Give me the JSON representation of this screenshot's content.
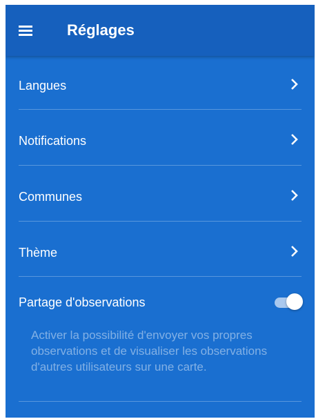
{
  "app_bar": {
    "title": "Réglages",
    "menu_icon": "menu-icon"
  },
  "settings": {
    "items": [
      {
        "label": "Langues",
        "icon": "chevron-right-icon"
      },
      {
        "label": "Notifications",
        "icon": "chevron-right-icon"
      },
      {
        "label": "Communes",
        "icon": "chevron-right-icon"
      },
      {
        "label": "Thème",
        "icon": "chevron-right-icon"
      }
    ],
    "share": {
      "label": "Partage d'observations",
      "enabled": true,
      "description": "Activer la possibilité d'envoyer vos propres observations et de visualiser les observations d'autres utilisateurs sur une carte."
    }
  },
  "colors": {
    "app_bar": "#1660bd",
    "background": "#1a6fd0",
    "text": "#ffffff"
  }
}
